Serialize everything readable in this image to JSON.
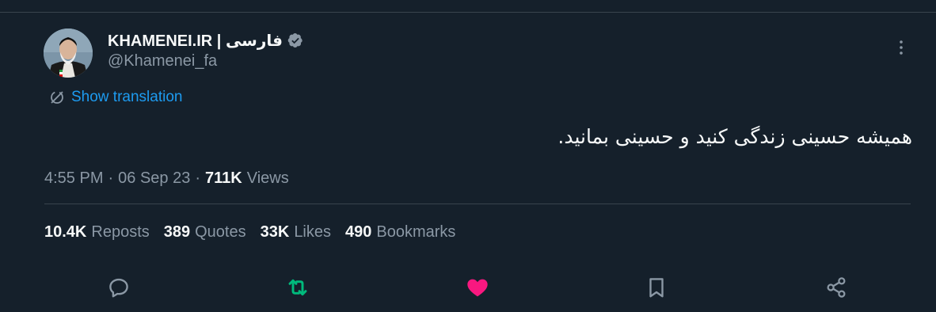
{
  "tweet": {
    "display_name": "KHAMENEI.IR | فارسی",
    "handle": "@Khamenei_fa",
    "show_translation": "Show translation",
    "text": "همیشه حسینی زندگی کنید و حسینی بمانید.",
    "time": "4:55 PM",
    "date": "06 Sep 23",
    "separator": "·",
    "views_count": "711K",
    "views_label": "Views"
  },
  "stats": {
    "reposts_count": "10.4K",
    "reposts_label": "Reposts",
    "quotes_count": "389",
    "quotes_label": "Quotes",
    "likes_count": "33K",
    "likes_label": "Likes",
    "bookmarks_count": "490",
    "bookmarks_label": "Bookmarks"
  },
  "colors": {
    "background": "#15202b",
    "text": "#f7f9f9",
    "muted": "#8b98a5",
    "link": "#1d9bf0",
    "repost_active": "#00ba7c",
    "like_active": "#f91880",
    "verified_badge": "#8b98a5"
  },
  "icons": {
    "verified": "verified-badge-icon",
    "more": "more-icon",
    "translate": "translate-icon",
    "reply": "reply-icon",
    "repost": "repost-icon",
    "like": "like-icon",
    "bookmark": "bookmark-icon",
    "share": "share-icon"
  }
}
